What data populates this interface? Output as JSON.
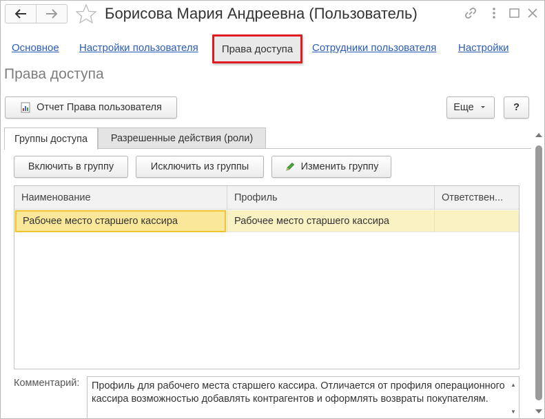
{
  "window": {
    "title": "Борисова Мария Андреевна (Пользователь)"
  },
  "sections": {
    "main": "Основное",
    "user_settings": "Настройки пользователя",
    "access_rights": "Права доступа",
    "user_employees": "Сотрудники пользователя",
    "settings": "Настройки"
  },
  "page": {
    "header": "Права доступа"
  },
  "toolbar": {
    "report_label": "Отчет Права пользователя",
    "more_label": "Еще",
    "help_label": "?"
  },
  "tabs": [
    {
      "label": "Группы доступа",
      "active": true
    },
    {
      "label": "Разрешенные действия (роли)",
      "active": false
    }
  ],
  "group_toolbar": {
    "include_label": "Включить в группу",
    "exclude_label": "Исключить из группы",
    "edit_label": "Изменить группу"
  },
  "table": {
    "columns": [
      "Наименование",
      "Профиль",
      "Ответствен..."
    ],
    "rows": [
      [
        "Рабочее место старшего кассира",
        "Рабочее место старшего кассира",
        ""
      ]
    ]
  },
  "comment": {
    "label": "Комментарий:",
    "text": "Профиль для рабочего места старшего кассира. Отличается от профиля операционного кассира возможностью добавлять контрагентов и оформлять возвраты покупателям."
  },
  "colors": {
    "link": "#2a5cb8",
    "highlight_border": "#e01c22",
    "selected_row": "#fbf2c4",
    "selected_cell_border": "#f1c232"
  },
  "icons": [
    "back-arrow-icon",
    "forward-arrow-icon",
    "star-icon",
    "link-icon",
    "more-vert-icon",
    "maximize-icon",
    "close-icon",
    "report-icon",
    "dropdown-icon",
    "pencil-icon",
    "scroll-up-icon",
    "scroll-down-icon"
  ]
}
